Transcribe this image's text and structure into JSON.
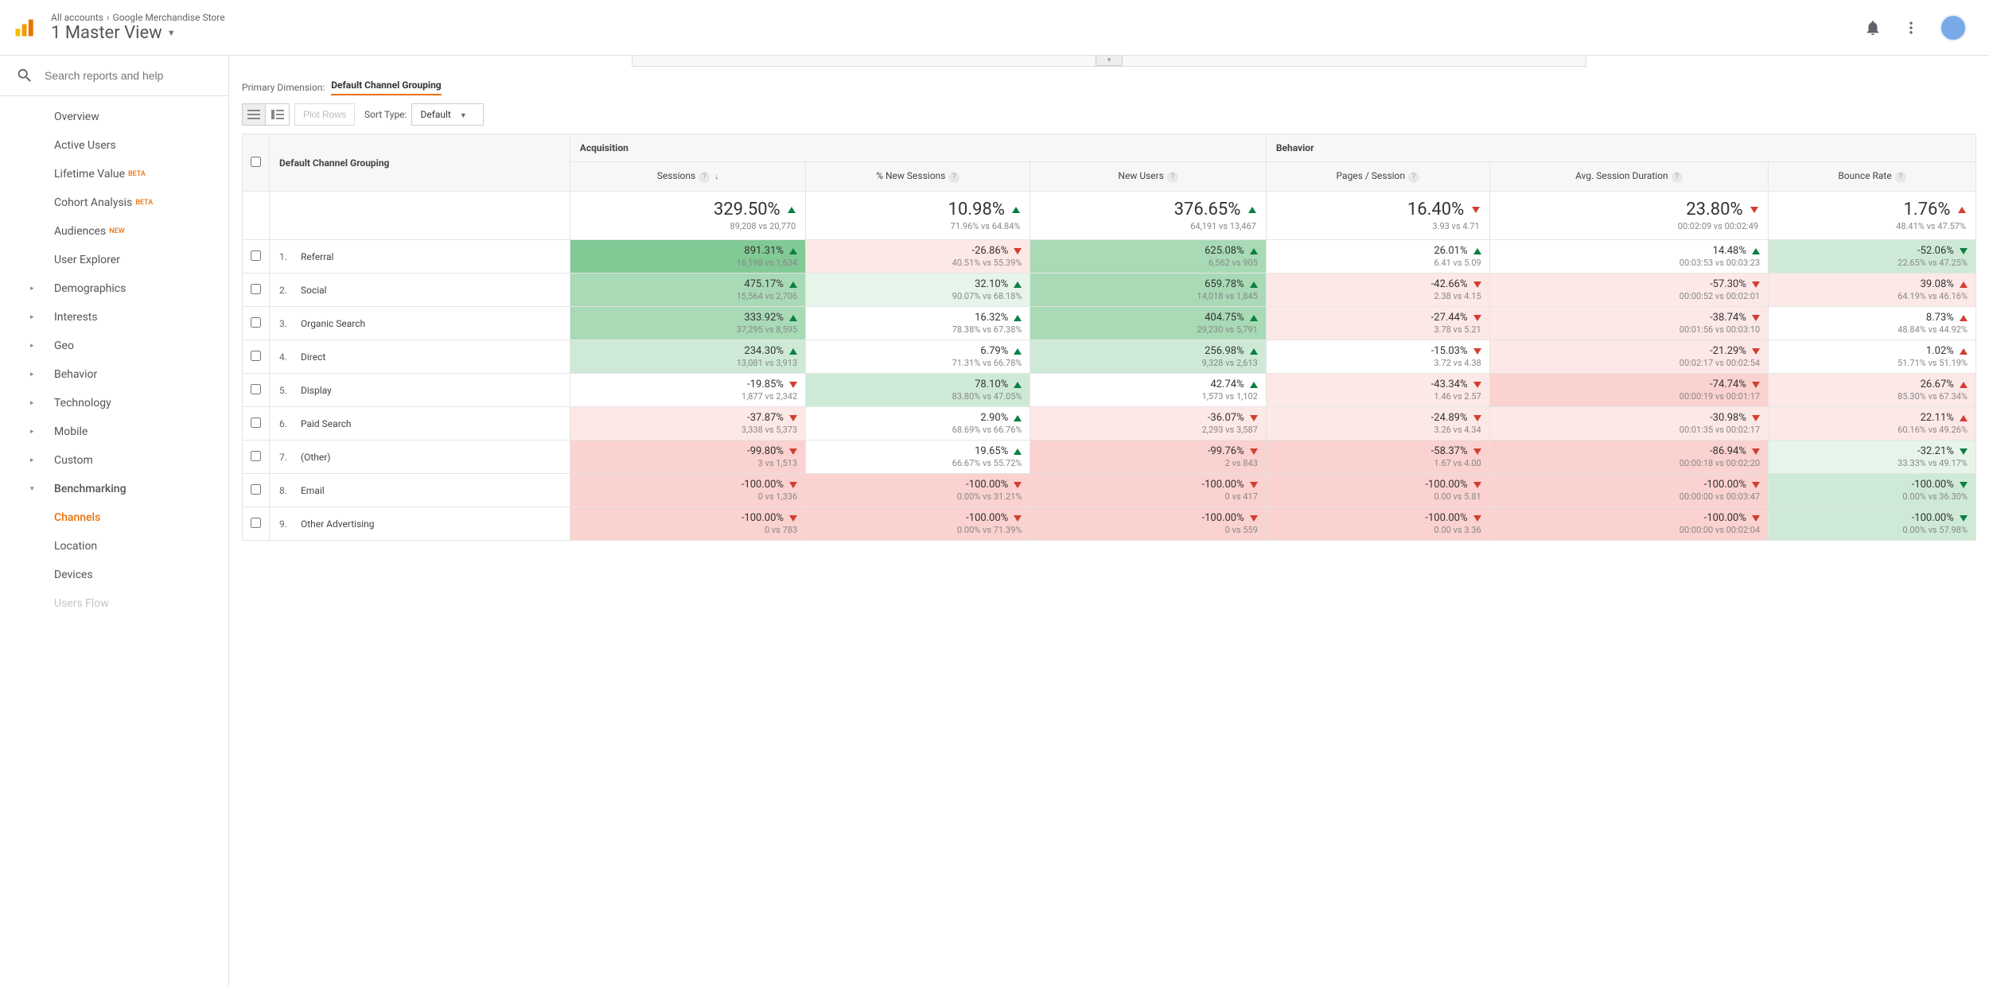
{
  "breadcrumb": {
    "parent": "All accounts",
    "property": "Google Merchandise Store"
  },
  "view_title": "1 Master View",
  "search_placeholder": "Search reports and help",
  "nav": {
    "overview": "Overview",
    "active_users": "Active Users",
    "lifetime_value": "Lifetime Value",
    "lifetime_badge": "BETA",
    "cohort": "Cohort Analysis",
    "cohort_badge": "BETA",
    "audiences": "Audiences",
    "audiences_badge": "NEW",
    "user_explorer": "User Explorer",
    "demographics": "Demographics",
    "interests": "Interests",
    "geo": "Geo",
    "behavior": "Behavior",
    "technology": "Technology",
    "mobile": "Mobile",
    "custom": "Custom",
    "benchmarking": "Benchmarking",
    "channels": "Channels",
    "location": "Location",
    "devices": "Devices",
    "users_flow": "Users Flow"
  },
  "primary_dim_label": "Primary Dimension:",
  "primary_dim_value": "Default Channel Grouping",
  "plot_rows": "Plot Rows",
  "sort_type_label": "Sort Type:",
  "sort_type_value": "Default",
  "columns": {
    "dim": "Default Channel Grouping",
    "acquisition": "Acquisition",
    "behavior_group": "Behavior",
    "sessions": "Sessions",
    "new_sessions_pct": "% New Sessions",
    "new_users": "New Users",
    "pages_session": "Pages / Session",
    "avg_duration": "Avg. Session Duration",
    "bounce_rate": "Bounce Rate"
  },
  "summary": {
    "sessions": {
      "val": "329.50%",
      "dir": "up",
      "sub": "89,208 vs 20,770"
    },
    "new_sessions_pct": {
      "val": "10.98%",
      "dir": "up",
      "sub": "71.96% vs 64.84%"
    },
    "new_users": {
      "val": "376.65%",
      "dir": "up",
      "sub": "64,191 vs 13,467"
    },
    "pages_session": {
      "val": "16.40%",
      "dir": "down",
      "sub": "3.93 vs 4.71"
    },
    "avg_duration": {
      "val": "23.80%",
      "dir": "down",
      "sub": "00:02:09 vs 00:02:49"
    },
    "bounce_rate": {
      "val": "1.76%",
      "dir": "up-bad",
      "sub": "48.41% vs 47.57%"
    }
  },
  "rows": [
    {
      "idx": "1.",
      "name": "Referral",
      "sessions": {
        "val": "891.31%",
        "dir": "up",
        "sub": "16,198 vs 1,634",
        "bg": "bg-g4"
      },
      "new_pct": {
        "val": "-26.86%",
        "dir": "down",
        "sub": "40.51% vs 55.39%",
        "bg": "bg-r1"
      },
      "new_users": {
        "val": "625.08%",
        "dir": "up",
        "sub": "6,562 vs 905",
        "bg": "bg-g3"
      },
      "pages": {
        "val": "26.01%",
        "dir": "up",
        "sub": "6.41 vs 5.09",
        "bg": ""
      },
      "duration": {
        "val": "14.48%",
        "dir": "up",
        "sub": "00:03:53 vs 00:03:23",
        "bg": ""
      },
      "bounce": {
        "val": "-52.06%",
        "dir": "down-good",
        "sub": "22.65% vs 47.25%",
        "bg": "bg-g2"
      }
    },
    {
      "idx": "2.",
      "name": "Social",
      "sessions": {
        "val": "475.17%",
        "dir": "up",
        "sub": "15,564 vs 2,706",
        "bg": "bg-g3"
      },
      "new_pct": {
        "val": "32.10%",
        "dir": "up",
        "sub": "90.07% vs 68.18%",
        "bg": "bg-g1"
      },
      "new_users": {
        "val": "659.78%",
        "dir": "up",
        "sub": "14,018 vs 1,845",
        "bg": "bg-g3"
      },
      "pages": {
        "val": "-42.66%",
        "dir": "down",
        "sub": "2.38 vs 4.15",
        "bg": "bg-r1"
      },
      "duration": {
        "val": "-57.30%",
        "dir": "down",
        "sub": "00:00:52 vs 00:02:01",
        "bg": "bg-r1"
      },
      "bounce": {
        "val": "39.08%",
        "dir": "up-bad",
        "sub": "64.19% vs 46.16%",
        "bg": "bg-r1"
      }
    },
    {
      "idx": "3.",
      "name": "Organic Search",
      "sessions": {
        "val": "333.92%",
        "dir": "up",
        "sub": "37,295 vs 8,595",
        "bg": "bg-g3"
      },
      "new_pct": {
        "val": "16.32%",
        "dir": "up",
        "sub": "78.38% vs 67.38%",
        "bg": ""
      },
      "new_users": {
        "val": "404.75%",
        "dir": "up",
        "sub": "29,230 vs 5,791",
        "bg": "bg-g3"
      },
      "pages": {
        "val": "-27.44%",
        "dir": "down",
        "sub": "3.78 vs 5.21",
        "bg": "bg-r1"
      },
      "duration": {
        "val": "-38.74%",
        "dir": "down",
        "sub": "00:01:56 vs 00:03:10",
        "bg": "bg-r1"
      },
      "bounce": {
        "val": "8.73%",
        "dir": "up-bad",
        "sub": "48.84% vs 44.92%",
        "bg": ""
      }
    },
    {
      "idx": "4.",
      "name": "Direct",
      "sessions": {
        "val": "234.30%",
        "dir": "up",
        "sub": "13,081 vs 3,913",
        "bg": "bg-g2"
      },
      "new_pct": {
        "val": "6.79%",
        "dir": "up",
        "sub": "71.31% vs 66.78%",
        "bg": ""
      },
      "new_users": {
        "val": "256.98%",
        "dir": "up",
        "sub": "9,328 vs 2,613",
        "bg": "bg-g2"
      },
      "pages": {
        "val": "-15.03%",
        "dir": "down",
        "sub": "3.72 vs 4.38",
        "bg": ""
      },
      "duration": {
        "val": "-21.29%",
        "dir": "down",
        "sub": "00:02:17 vs 00:02:54",
        "bg": "bg-r1"
      },
      "bounce": {
        "val": "1.02%",
        "dir": "up-bad",
        "sub": "51.71% vs 51.19%",
        "bg": ""
      }
    },
    {
      "idx": "5.",
      "name": "Display",
      "sessions": {
        "val": "-19.85%",
        "dir": "down",
        "sub": "1,877 vs 2,342",
        "bg": ""
      },
      "new_pct": {
        "val": "78.10%",
        "dir": "up",
        "sub": "83.80% vs 47.05%",
        "bg": "bg-g2"
      },
      "new_users": {
        "val": "42.74%",
        "dir": "up",
        "sub": "1,573 vs 1,102",
        "bg": ""
      },
      "pages": {
        "val": "-43.34%",
        "dir": "down",
        "sub": "1.46 vs 2.57",
        "bg": "bg-r1"
      },
      "duration": {
        "val": "-74.74%",
        "dir": "down",
        "sub": "00:00:19 vs 00:01:17",
        "bg": "bg-r2"
      },
      "bounce": {
        "val": "26.67%",
        "dir": "up-bad",
        "sub": "85.30% vs 67.34%",
        "bg": "bg-r1"
      }
    },
    {
      "idx": "6.",
      "name": "Paid Search",
      "sessions": {
        "val": "-37.87%",
        "dir": "down",
        "sub": "3,338 vs 5,373",
        "bg": "bg-r1"
      },
      "new_pct": {
        "val": "2.90%",
        "dir": "up",
        "sub": "68.69% vs 66.76%",
        "bg": ""
      },
      "new_users": {
        "val": "-36.07%",
        "dir": "down",
        "sub": "2,293 vs 3,587",
        "bg": "bg-r1"
      },
      "pages": {
        "val": "-24.89%",
        "dir": "down",
        "sub": "3.26 vs 4.34",
        "bg": "bg-r1"
      },
      "duration": {
        "val": "-30.98%",
        "dir": "down",
        "sub": "00:01:35 vs 00:02:17",
        "bg": "bg-r1"
      },
      "bounce": {
        "val": "22.11%",
        "dir": "up-bad",
        "sub": "60.16% vs 49.26%",
        "bg": "bg-r1"
      }
    },
    {
      "idx": "7.",
      "name": "(Other)",
      "sessions": {
        "val": "-99.80%",
        "dir": "down",
        "sub": "3 vs 1,513",
        "bg": "bg-r2"
      },
      "new_pct": {
        "val": "19.65%",
        "dir": "up",
        "sub": "66.67% vs 55.72%",
        "bg": ""
      },
      "new_users": {
        "val": "-99.76%",
        "dir": "down",
        "sub": "2 vs 843",
        "bg": "bg-r2"
      },
      "pages": {
        "val": "-58.37%",
        "dir": "down",
        "sub": "1.67 vs 4.00",
        "bg": "bg-r2"
      },
      "duration": {
        "val": "-86.94%",
        "dir": "down",
        "sub": "00:00:18 vs 00:02:20",
        "bg": "bg-r2"
      },
      "bounce": {
        "val": "-32.21%",
        "dir": "down-good",
        "sub": "33.33% vs 49.17%",
        "bg": "bg-g1"
      }
    },
    {
      "idx": "8.",
      "name": "Email",
      "sessions": {
        "val": "-100.00%",
        "dir": "down",
        "sub": "0 vs 1,336",
        "bg": "bg-r2"
      },
      "new_pct": {
        "val": "-100.00%",
        "dir": "down",
        "sub": "0.00% vs 31.21%",
        "bg": "bg-r2"
      },
      "new_users": {
        "val": "-100.00%",
        "dir": "down",
        "sub": "0 vs 417",
        "bg": "bg-r2"
      },
      "pages": {
        "val": "-100.00%",
        "dir": "down",
        "sub": "0.00 vs 5.81",
        "bg": "bg-r2"
      },
      "duration": {
        "val": "-100.00%",
        "dir": "down",
        "sub": "00:00:00 vs 00:03:47",
        "bg": "bg-r2"
      },
      "bounce": {
        "val": "-100.00%",
        "dir": "down-good",
        "sub": "0.00% vs 36.30%",
        "bg": "bg-g2"
      }
    },
    {
      "idx": "9.",
      "name": "Other Advertising",
      "sessions": {
        "val": "-100.00%",
        "dir": "down",
        "sub": "0 vs 783",
        "bg": "bg-r2"
      },
      "new_pct": {
        "val": "-100.00%",
        "dir": "down",
        "sub": "0.00% vs 71.39%",
        "bg": "bg-r2"
      },
      "new_users": {
        "val": "-100.00%",
        "dir": "down",
        "sub": "0 vs 559",
        "bg": "bg-r2"
      },
      "pages": {
        "val": "-100.00%",
        "dir": "down",
        "sub": "0.00 vs 3.36",
        "bg": "bg-r2"
      },
      "duration": {
        "val": "-100.00%",
        "dir": "down",
        "sub": "00:00:00 vs 00:02:04",
        "bg": "bg-r2"
      },
      "bounce": {
        "val": "-100.00%",
        "dir": "down-good",
        "sub": "0.00% vs 57.98%",
        "bg": "bg-g2"
      }
    }
  ]
}
